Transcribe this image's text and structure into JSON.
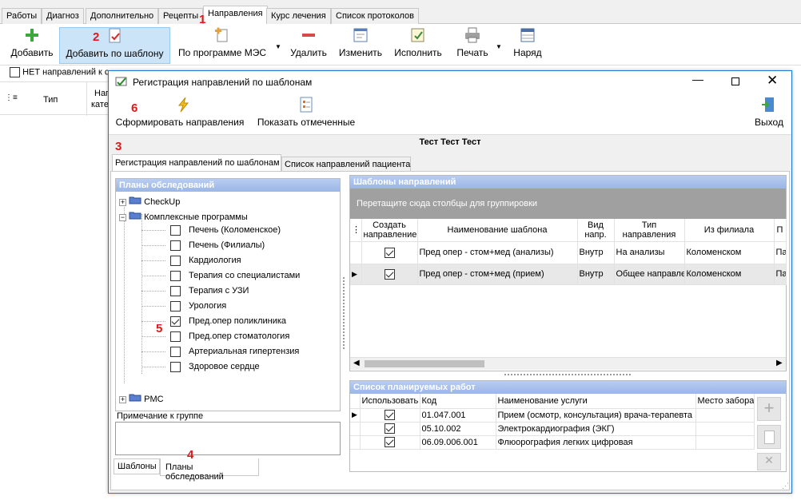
{
  "tabs": [
    "Работы",
    "Диагноз",
    "Дополнительно",
    "Рецепты",
    "Направления",
    "Курс лечения",
    "Список протоколов"
  ],
  "toolbar": {
    "add": "Добавить",
    "add_template": "Добавить по шаблону",
    "by_mes": "По программе МЭС",
    "delete": "Удалить",
    "edit": "Изменить",
    "execute": "Исполнить",
    "print": "Печать",
    "order": "Наряд"
  },
  "no_directions": "НЕТ направлений к с",
  "bg_cols": {
    "type": "Тип",
    "napr": "Нап",
    "kat": "кате"
  },
  "markers": {
    "m1": "1",
    "m2": "2",
    "m3": "3",
    "m4": "4",
    "m5": "5",
    "m6": "6"
  },
  "dialog": {
    "title": "Регистрация направлений по шаблонам",
    "form_btn": "Сформировать направления",
    "show_btn": "Показать отмеченные",
    "exit_btn": "Выход",
    "patient": "Тест Тест Тест",
    "tabs": [
      "Регистрация направлений по шаблонам",
      "Список направлений пациента"
    ],
    "plans_header": "Планы обследований",
    "tree": {
      "checkup": "CheckUp",
      "complex": "Комплексные программы",
      "pmc": "PMC",
      "items": [
        {
          "label": "Печень (Коломенское)",
          "checked": false
        },
        {
          "label": "Печень (Филиалы)",
          "checked": false
        },
        {
          "label": "Кардиология",
          "checked": false
        },
        {
          "label": "Терапия со специалистами",
          "checked": false
        },
        {
          "label": "Терапия с УЗИ",
          "checked": false
        },
        {
          "label": "Урология",
          "checked": false
        },
        {
          "label": "Пред.опер поликлиника",
          "checked": true
        },
        {
          "label": "Пред.опер стоматология",
          "checked": false
        },
        {
          "label": "Артериальная гипертензия",
          "checked": false
        },
        {
          "label": "Здоровое сердце",
          "checked": false
        }
      ]
    },
    "note_label": "Примечание к группе",
    "bottom_tabs": [
      "Шаблоны",
      "Планы обследований"
    ],
    "templates_header": "Шаблоны направлений",
    "group_hint": "Перетащите сюда столбцы для группировки",
    "tcols": [
      "Создать направление",
      "Наименование шаблона",
      "Вид напр.",
      "Тип направления",
      "Из филиала",
      "П"
    ],
    "trows": [
      {
        "name": "Пред опер - стом+мед (анализы)",
        "vid": "Внутр",
        "type": "На анализы",
        "branch": "Коломенском",
        "p": "Па"
      },
      {
        "name": "Пред опер - стом+мед (прием)",
        "vid": "Внутр",
        "type": "Общее направле",
        "branch": "Коломенском",
        "p": "Па"
      }
    ],
    "works_header": "Список планируемых работ",
    "wcols": [
      "Использовать",
      "Код",
      "Наименование услуги",
      "Место забора"
    ],
    "wrows": [
      {
        "code": "01.047.001",
        "name": "Прием (осмотр, консультация) врача-терапевта"
      },
      {
        "code": "05.10.002",
        "name": "Электрокардиография (ЭКГ)"
      },
      {
        "code": "06.09.006.001",
        "name": "Флюорография легких цифровая"
      }
    ]
  }
}
